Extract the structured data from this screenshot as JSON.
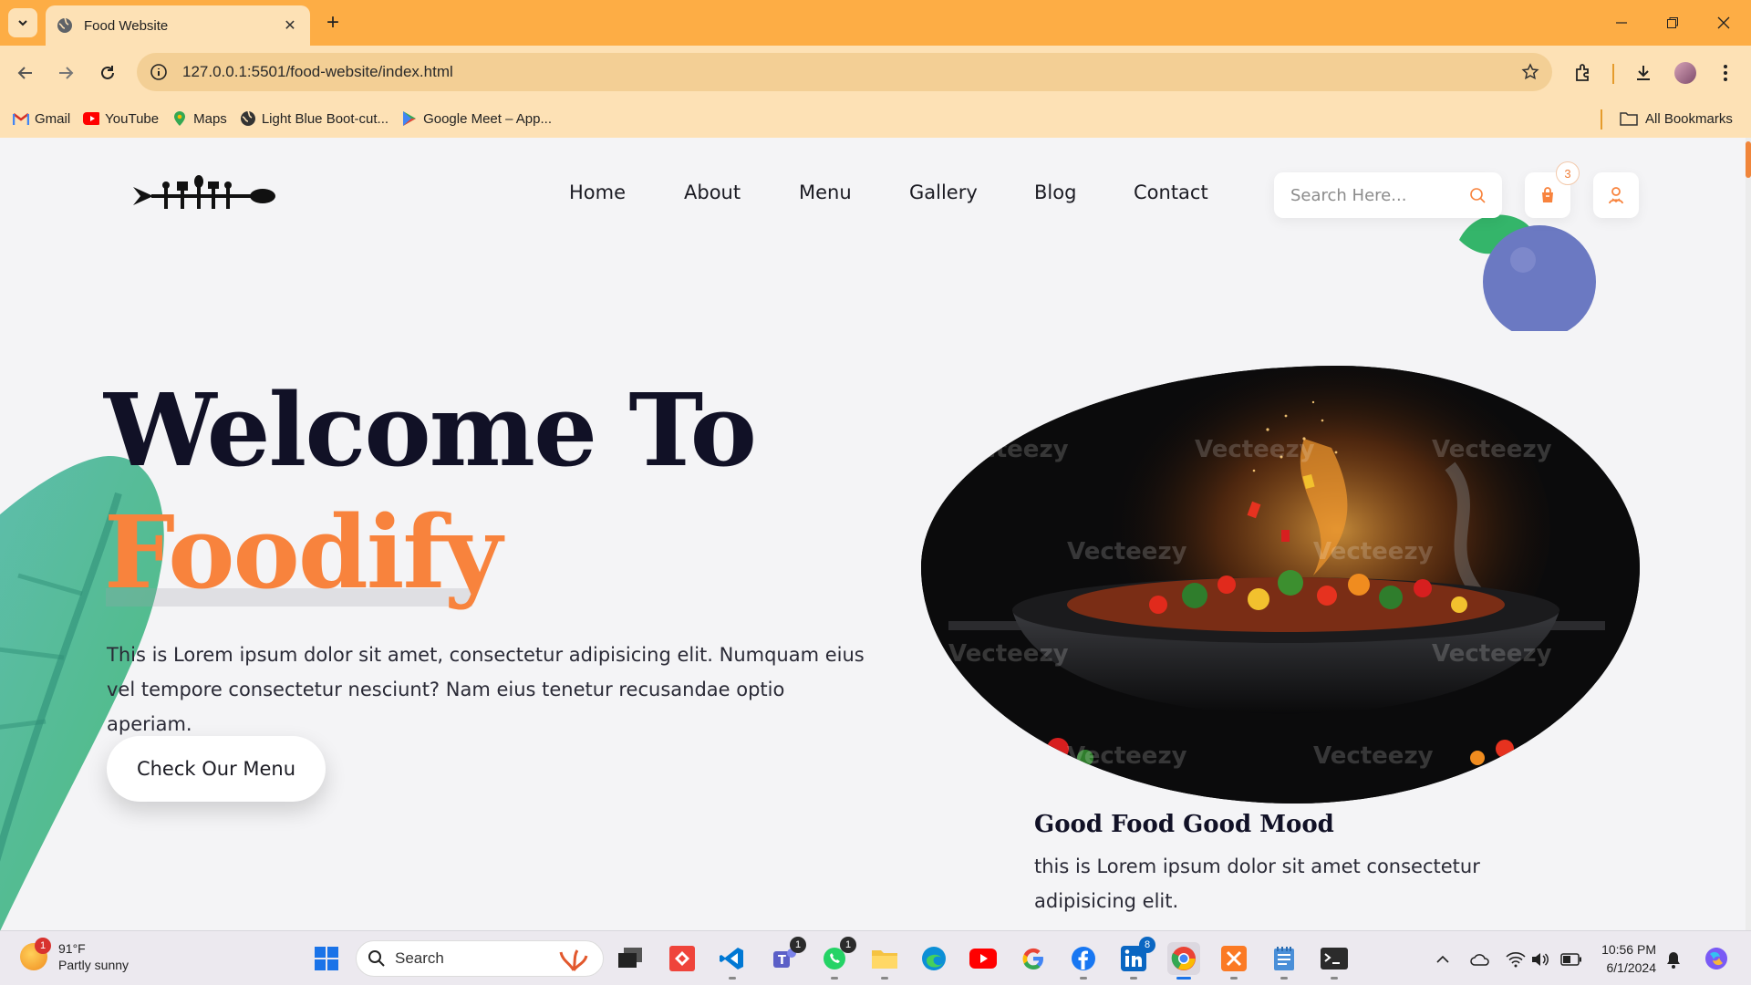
{
  "browser": {
    "tab_title": "Food Website",
    "url": "127.0.0.1:5501/food-website/index.html",
    "bookmarks": [
      {
        "label": "Gmail",
        "icon": "gmail-icon"
      },
      {
        "label": "YouTube",
        "icon": "youtube-icon"
      },
      {
        "label": "Maps",
        "icon": "maps-icon"
      },
      {
        "label": "Light Blue Boot-cut...",
        "icon": "globe-icon"
      },
      {
        "label": "Google Meet – App...",
        "icon": "google-play-icon"
      }
    ],
    "all_bookmarks_label": "All Bookmarks",
    "accent_color": "#fdad45"
  },
  "site": {
    "nav": [
      "Home",
      "About",
      "Menu",
      "Gallery",
      "Blog",
      "Contact"
    ],
    "search_placeholder": "Search Here...",
    "cart_count": "3",
    "hero": {
      "title_line1": "Welcome To",
      "title_line2": "Foodify",
      "description": "This is Lorem ipsum dolor sit amet, consectetur adipisicing elit. Numquam eius vel tempore consectetur nesciunt? Nam eius tenetur recusandae optio aperiam.",
      "cta_label": "Check Our Menu"
    },
    "card": {
      "title": "Good Food Good Mood",
      "description": "this is Lorem ipsum dolor sit amet consectetur adipisicing elit."
    },
    "image_watermark": "Vecteezy",
    "accent_color": "#f8833d",
    "dark_color": "#111126"
  },
  "taskbar": {
    "weather_temp": "91°F",
    "weather_desc": "Partly sunny",
    "weather_badge": "1",
    "search_label": "Search",
    "teams_badge": "1",
    "whatsapp_badge": "1",
    "linkedin_badge": "8",
    "time": "10:56 PM",
    "date": "6/1/2024"
  }
}
